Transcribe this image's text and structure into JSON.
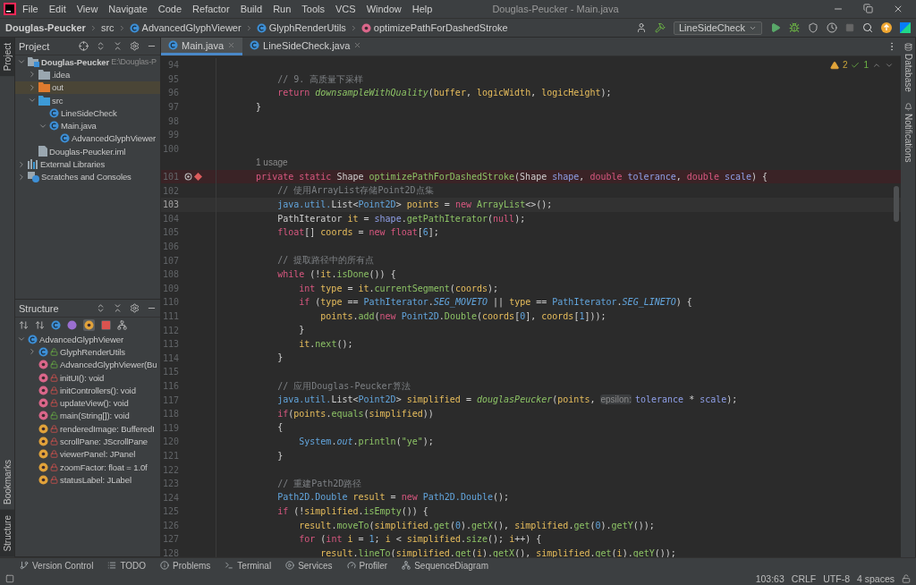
{
  "title_bar": {
    "menu": [
      "File",
      "Edit",
      "View",
      "Navigate",
      "Code",
      "Refactor",
      "Build",
      "Run",
      "Tools",
      "VCS",
      "Window",
      "Help"
    ],
    "title": "Douglas-Peucker - Main.java"
  },
  "nav_bar": {
    "breadcrumbs": [
      {
        "kind": "project",
        "label": "Douglas-Peucker"
      },
      {
        "kind": "folder",
        "label": "src"
      },
      {
        "kind": "class",
        "label": "AdvancedGlyphViewer"
      },
      {
        "kind": "inner-class",
        "label": "GlyphRenderUtils"
      },
      {
        "kind": "method",
        "label": "optimizePathForDashedStroke"
      }
    ],
    "run_config": "LineSideCheck"
  },
  "left_stripe": {
    "top": [
      {
        "label": "Project",
        "selected": true
      }
    ],
    "bottom": [
      {
        "label": "Bookmarks",
        "selected": false
      },
      {
        "label": "Structure",
        "selected": true
      }
    ]
  },
  "right_stripe": [
    {
      "label": "Database"
    },
    {
      "label": "Notifications"
    }
  ],
  "project_panel": {
    "title": "Project",
    "tree": [
      {
        "label": "Douglas-Peucker",
        "hint": "E:\\Douglas-P",
        "kind": "module",
        "expanded": true,
        "selected": false,
        "children": [
          {
            "label": ".idea",
            "kind": "folder",
            "expanded": false,
            "selected": false
          },
          {
            "label": "out",
            "kind": "excluded",
            "expanded": false,
            "selected": true
          },
          {
            "label": "src",
            "kind": "source",
            "expanded": true,
            "selected": false,
            "children": [
              {
                "label": "LineSideCheck",
                "kind": "class",
                "selected": false
              },
              {
                "label": "Main.java",
                "kind": "class",
                "expanded": true,
                "selected": false,
                "children": [
                  {
                    "label": "AdvancedGlyphViewer",
                    "kind": "class",
                    "selected": false
                  }
                ]
              }
            ]
          },
          {
            "label": "Douglas-Peucker.iml",
            "kind": "file",
            "selected": false
          }
        ]
      },
      {
        "label": "External Libraries",
        "kind": "library",
        "expanded": false,
        "selected": false
      },
      {
        "label": "Scratches and Consoles",
        "kind": "scratches",
        "expanded": false,
        "selected": false
      }
    ]
  },
  "structure_panel": {
    "title": "Structure",
    "tree": [
      {
        "label": "AdvancedGlyphViewer",
        "kind": "class",
        "expanded": true,
        "children": [
          {
            "label": "GlyphRenderUtils",
            "kind": "public-class",
            "expanded": false
          },
          {
            "label": "AdvancedGlyphViewer(Bu",
            "kind": "public-method"
          },
          {
            "label": "initUI(): void",
            "kind": "private-method"
          },
          {
            "label": "initControllers(): void",
            "kind": "private-method"
          },
          {
            "label": "updateView(): void",
            "kind": "private-method"
          },
          {
            "label": "main(String[]): void",
            "kind": "public-method"
          },
          {
            "label": "renderedImage: BufferedI",
            "kind": "private-field"
          },
          {
            "label": "scrollPane: JScrollPane",
            "kind": "private-field"
          },
          {
            "label": "viewerPanel: JPanel",
            "kind": "private-field"
          },
          {
            "label": "zoomFactor: float = 1.0f",
            "kind": "private-field"
          },
          {
            "label": "statusLabel: JLabel",
            "kind": "private-field"
          }
        ]
      }
    ]
  },
  "editor": {
    "tabs": [
      {
        "label": "Main.java",
        "selected": true
      },
      {
        "label": "LineSideCheck.java",
        "selected": false
      }
    ],
    "inspections": {
      "warnings": "2",
      "checks": "1"
    },
    "lines": [
      {
        "number": "94",
        "kind": "normal"
      },
      {
        "number": "95",
        "kind": "normal",
        "tokens": [
          {
            "kind": "comment",
            "text": "        // 9. 高质量下采样"
          }
        ]
      },
      {
        "number": "96",
        "kind": "normal",
        "tokens": [
          {
            "kind": "kw",
            "text": "        return "
          },
          {
            "kind": "static",
            "text": "downsampleWithQuality"
          },
          {
            "kind": "plain",
            "text": "("
          },
          {
            "kind": "var",
            "text": "buffer"
          },
          {
            "kind": "plain",
            "text": ", "
          },
          {
            "kind": "var",
            "text": "logicWidth"
          },
          {
            "kind": "plain",
            "text": ", "
          },
          {
            "kind": "var",
            "text": "logicHeight"
          },
          {
            "kind": "plain",
            "text": ");"
          }
        ]
      },
      {
        "number": "97",
        "kind": "normal",
        "tokens": [
          {
            "kind": "plain",
            "text": "    }"
          }
        ]
      },
      {
        "number": "98",
        "kind": "normal"
      },
      {
        "number": "99",
        "kind": "normal"
      },
      {
        "number": "100",
        "kind": "normal"
      },
      {
        "kind": "usage",
        "text": "1 usage"
      },
      {
        "number": "101",
        "kind": "breakpoint",
        "tokens": [
          {
            "kind": "kw",
            "text": "    private static "
          },
          {
            "kind": "plain",
            "text": "Shape "
          },
          {
            "kind": "method",
            "text": "optimizePathForDashedStroke"
          },
          {
            "kind": "plain",
            "text": "(Shape "
          },
          {
            "kind": "param",
            "text": "shape"
          },
          {
            "kind": "plain",
            "text": ", "
          },
          {
            "kind": "kw",
            "text": "double "
          },
          {
            "kind": "param",
            "text": "tolerance"
          },
          {
            "kind": "plain",
            "text": ", "
          },
          {
            "kind": "kw",
            "text": "double "
          },
          {
            "kind": "param",
            "text": "scale"
          },
          {
            "kind": "plain",
            "text": ") {"
          }
        ]
      },
      {
        "number": "102",
        "kind": "normal",
        "tokens": [
          {
            "kind": "comment",
            "text": "        // 使用ArrayList存储Point2D点集"
          }
        ]
      },
      {
        "number": "103",
        "kind": "caret",
        "tokens": [
          {
            "kind": "type",
            "text": "        java.util."
          },
          {
            "kind": "plain",
            "text": "List<"
          },
          {
            "kind": "type",
            "text": "Point2D"
          },
          {
            "kind": "plain",
            "text": "> "
          },
          {
            "kind": "var",
            "text": "points"
          },
          {
            "kind": "plain",
            "text": " = "
          },
          {
            "kind": "kw",
            "text": "new "
          },
          {
            "kind": "method",
            "text": "ArrayList"
          },
          {
            "kind": "plain",
            "text": "<>();"
          }
        ]
      },
      {
        "number": "104",
        "kind": "normal",
        "tokens": [
          {
            "kind": "plain",
            "text": "        PathIterator "
          },
          {
            "kind": "var",
            "text": "it"
          },
          {
            "kind": "plain",
            "text": " = "
          },
          {
            "kind": "param",
            "text": "shape"
          },
          {
            "kind": "plain",
            "text": "."
          },
          {
            "kind": "method",
            "text": "getPathIterator"
          },
          {
            "kind": "plain",
            "text": "("
          },
          {
            "kind": "kw",
            "text": "null"
          },
          {
            "kind": "plain",
            "text": ");"
          }
        ]
      },
      {
        "number": "105",
        "kind": "normal",
        "tokens": [
          {
            "kind": "kw",
            "text": "        float"
          },
          {
            "kind": "plain",
            "text": "[] "
          },
          {
            "kind": "var",
            "text": "coords"
          },
          {
            "kind": "plain",
            "text": " = "
          },
          {
            "kind": "kw",
            "text": "new float"
          },
          {
            "kind": "plain",
            "text": "["
          },
          {
            "kind": "number",
            "text": "6"
          },
          {
            "kind": "plain",
            "text": "];"
          }
        ]
      },
      {
        "number": "106",
        "kind": "normal"
      },
      {
        "number": "107",
        "kind": "normal",
        "tokens": [
          {
            "kind": "comment",
            "text": "        // 提取路径中的所有点"
          }
        ]
      },
      {
        "number": "108",
        "kind": "normal",
        "tokens": [
          {
            "kind": "kw",
            "text": "        while "
          },
          {
            "kind": "plain",
            "text": "(!"
          },
          {
            "kind": "var",
            "text": "it"
          },
          {
            "kind": "plain",
            "text": "."
          },
          {
            "kind": "method",
            "text": "isDone"
          },
          {
            "kind": "plain",
            "text": "()) {"
          }
        ]
      },
      {
        "number": "109",
        "kind": "normal",
        "tokens": [
          {
            "kind": "kw",
            "text": "            int "
          },
          {
            "kind": "var",
            "text": "type"
          },
          {
            "kind": "plain",
            "text": " = "
          },
          {
            "kind": "var",
            "text": "it"
          },
          {
            "kind": "plain",
            "text": "."
          },
          {
            "kind": "method",
            "text": "currentSegment"
          },
          {
            "kind": "plain",
            "text": "("
          },
          {
            "kind": "var",
            "text": "coords"
          },
          {
            "kind": "plain",
            "text": ");"
          }
        ]
      },
      {
        "number": "110",
        "kind": "normal",
        "tokens": [
          {
            "kind": "kw",
            "text": "            if "
          },
          {
            "kind": "plain",
            "text": "("
          },
          {
            "kind": "var",
            "text": "type"
          },
          {
            "kind": "plain",
            "text": " == "
          },
          {
            "kind": "type",
            "text": "PathIterator"
          },
          {
            "kind": "plain",
            "text": "."
          },
          {
            "kind": "const",
            "text": "SEG_MOVETO"
          },
          {
            "kind": "plain",
            "text": " || "
          },
          {
            "kind": "var",
            "text": "type"
          },
          {
            "kind": "plain",
            "text": " == "
          },
          {
            "kind": "type",
            "text": "PathIterator"
          },
          {
            "kind": "plain",
            "text": "."
          },
          {
            "kind": "const",
            "text": "SEG_LINETO"
          },
          {
            "kind": "plain",
            "text": ") {"
          }
        ]
      },
      {
        "number": "111",
        "kind": "normal",
        "tokens": [
          {
            "kind": "var",
            "text": "                points"
          },
          {
            "kind": "plain",
            "text": "."
          },
          {
            "kind": "method",
            "text": "add"
          },
          {
            "kind": "plain",
            "text": "("
          },
          {
            "kind": "kw",
            "text": "new "
          },
          {
            "kind": "type",
            "text": "Point2D"
          },
          {
            "kind": "plain",
            "text": "."
          },
          {
            "kind": "method",
            "text": "Double"
          },
          {
            "kind": "plain",
            "text": "("
          },
          {
            "kind": "var",
            "text": "coords"
          },
          {
            "kind": "plain",
            "text": "["
          },
          {
            "kind": "number",
            "text": "0"
          },
          {
            "kind": "plain",
            "text": "], "
          },
          {
            "kind": "var",
            "text": "coords"
          },
          {
            "kind": "plain",
            "text": "["
          },
          {
            "kind": "number",
            "text": "1"
          },
          {
            "kind": "plain",
            "text": "]));"
          }
        ]
      },
      {
        "number": "112",
        "kind": "normal",
        "tokens": [
          {
            "kind": "plain",
            "text": "            }"
          }
        ]
      },
      {
        "number": "113",
        "kind": "normal",
        "tokens": [
          {
            "kind": "var",
            "text": "            it"
          },
          {
            "kind": "plain",
            "text": "."
          },
          {
            "kind": "method",
            "text": "next"
          },
          {
            "kind": "plain",
            "text": "();"
          }
        ]
      },
      {
        "number": "114",
        "kind": "normal",
        "tokens": [
          {
            "kind": "plain",
            "text": "        }"
          }
        ]
      },
      {
        "number": "115",
        "kind": "normal"
      },
      {
        "number": "116",
        "kind": "normal",
        "tokens": [
          {
            "kind": "comment",
            "text": "        // 应用Douglas-Peucker算法"
          }
        ]
      },
      {
        "number": "117",
        "kind": "normal",
        "tokens": [
          {
            "kind": "type",
            "text": "        java.util."
          },
          {
            "kind": "plain",
            "text": "List<"
          },
          {
            "kind": "type",
            "text": "Point2D"
          },
          {
            "kind": "plain",
            "text": "> "
          },
          {
            "kind": "var",
            "text": "simplified"
          },
          {
            "kind": "plain",
            "text": " = "
          },
          {
            "kind": "static",
            "text": "douglasPeucker"
          },
          {
            "kind": "plain",
            "text": "("
          },
          {
            "kind": "var",
            "text": "points"
          },
          {
            "kind": "plain",
            "text": ", "
          },
          {
            "kind": "hint",
            "text": "epsilon:"
          },
          {
            "kind": "param",
            "text": "tolerance"
          },
          {
            "kind": "plain",
            "text": " * "
          },
          {
            "kind": "param",
            "text": "scale"
          },
          {
            "kind": "plain",
            "text": ");"
          }
        ]
      },
      {
        "number": "118",
        "kind": "normal",
        "tokens": [
          {
            "kind": "kw",
            "text": "        if"
          },
          {
            "kind": "plain",
            "text": "("
          },
          {
            "kind": "var",
            "text": "points"
          },
          {
            "kind": "plain",
            "text": "."
          },
          {
            "kind": "method",
            "text": "equals"
          },
          {
            "kind": "plain",
            "text": "("
          },
          {
            "kind": "var",
            "text": "simplified"
          },
          {
            "kind": "plain",
            "text": "))"
          }
        ]
      },
      {
        "number": "119",
        "kind": "normal",
        "tokens": [
          {
            "kind": "plain",
            "text": "        {"
          }
        ]
      },
      {
        "number": "120",
        "kind": "normal",
        "tokens": [
          {
            "kind": "type",
            "text": "            System"
          },
          {
            "kind": "plain",
            "text": "."
          },
          {
            "kind": "const",
            "text": "out"
          },
          {
            "kind": "plain",
            "text": "."
          },
          {
            "kind": "method",
            "text": "println"
          },
          {
            "kind": "plain",
            "text": "("
          },
          {
            "kind": "string",
            "text": "\"ye\""
          },
          {
            "kind": "plain",
            "text": ");"
          }
        ]
      },
      {
        "number": "121",
        "kind": "normal",
        "tokens": [
          {
            "kind": "plain",
            "text": "        }"
          }
        ]
      },
      {
        "number": "122",
        "kind": "normal"
      },
      {
        "number": "123",
        "kind": "normal",
        "tokens": [
          {
            "kind": "comment",
            "text": "        // 重建Path2D路径"
          }
        ]
      },
      {
        "number": "124",
        "kind": "normal",
        "tokens": [
          {
            "kind": "type",
            "text": "        Path2D.Double "
          },
          {
            "kind": "var",
            "text": "result"
          },
          {
            "kind": "plain",
            "text": " = "
          },
          {
            "kind": "kw",
            "text": "new "
          },
          {
            "kind": "type",
            "text": "Path2D.Double"
          },
          {
            "kind": "plain",
            "text": "();"
          }
        ]
      },
      {
        "number": "125",
        "kind": "normal",
        "tokens": [
          {
            "kind": "kw",
            "text": "        if "
          },
          {
            "kind": "plain",
            "text": "(!"
          },
          {
            "kind": "var",
            "text": "simplified"
          },
          {
            "kind": "plain",
            "text": "."
          },
          {
            "kind": "method",
            "text": "isEmpty"
          },
          {
            "kind": "plain",
            "text": "()) {"
          }
        ]
      },
      {
        "number": "126",
        "kind": "normal",
        "tokens": [
          {
            "kind": "var",
            "text": "            result"
          },
          {
            "kind": "plain",
            "text": "."
          },
          {
            "kind": "method",
            "text": "moveTo"
          },
          {
            "kind": "plain",
            "text": "("
          },
          {
            "kind": "var",
            "text": "simplified"
          },
          {
            "kind": "plain",
            "text": "."
          },
          {
            "kind": "method",
            "text": "get"
          },
          {
            "kind": "plain",
            "text": "("
          },
          {
            "kind": "number",
            "text": "0"
          },
          {
            "kind": "plain",
            "text": ")."
          },
          {
            "kind": "method",
            "text": "getX"
          },
          {
            "kind": "plain",
            "text": "(), "
          },
          {
            "kind": "var",
            "text": "simplified"
          },
          {
            "kind": "plain",
            "text": "."
          },
          {
            "kind": "method",
            "text": "get"
          },
          {
            "kind": "plain",
            "text": "("
          },
          {
            "kind": "number",
            "text": "0"
          },
          {
            "kind": "plain",
            "text": ")."
          },
          {
            "kind": "method",
            "text": "getY"
          },
          {
            "kind": "plain",
            "text": "());"
          }
        ]
      },
      {
        "number": "127",
        "kind": "normal",
        "tokens": [
          {
            "kind": "kw",
            "text": "            for "
          },
          {
            "kind": "plain",
            "text": "("
          },
          {
            "kind": "kw",
            "text": "int "
          },
          {
            "kind": "var",
            "text": "i"
          },
          {
            "kind": "plain",
            "text": " = "
          },
          {
            "kind": "number",
            "text": "1"
          },
          {
            "kind": "plain",
            "text": "; "
          },
          {
            "kind": "var",
            "text": "i"
          },
          {
            "kind": "plain",
            "text": " < "
          },
          {
            "kind": "var",
            "text": "simplified"
          },
          {
            "kind": "plain",
            "text": "."
          },
          {
            "kind": "method",
            "text": "size"
          },
          {
            "kind": "plain",
            "text": "(); "
          },
          {
            "kind": "var",
            "text": "i"
          },
          {
            "kind": "plain",
            "text": "++) {"
          }
        ]
      },
      {
        "number": "128",
        "kind": "normal",
        "tokens": [
          {
            "kind": "var",
            "text": "                result"
          },
          {
            "kind": "plain",
            "text": "."
          },
          {
            "kind": "method",
            "text": "lineTo"
          },
          {
            "kind": "plain",
            "text": "("
          },
          {
            "kind": "var",
            "text": "simplified"
          },
          {
            "kind": "plain",
            "text": "."
          },
          {
            "kind": "method",
            "text": "get"
          },
          {
            "kind": "plain",
            "text": "("
          },
          {
            "kind": "var",
            "text": "i"
          },
          {
            "kind": "plain",
            "text": ")."
          },
          {
            "kind": "method",
            "text": "getX"
          },
          {
            "kind": "plain",
            "text": "(), "
          },
          {
            "kind": "var",
            "text": "simplified"
          },
          {
            "kind": "plain",
            "text": "."
          },
          {
            "kind": "method",
            "text": "get"
          },
          {
            "kind": "plain",
            "text": "("
          },
          {
            "kind": "var",
            "text": "i"
          },
          {
            "kind": "plain",
            "text": ")."
          },
          {
            "kind": "method",
            "text": "getY"
          },
          {
            "kind": "plain",
            "text": "());"
          }
        ]
      }
    ]
  },
  "bottom_tools": [
    {
      "kind": "vcs",
      "label": "Version Control"
    },
    {
      "kind": "todo",
      "label": "TODO"
    },
    {
      "kind": "problems",
      "label": "Problems"
    },
    {
      "kind": "terminal",
      "label": "Terminal"
    },
    {
      "kind": "services",
      "label": "Services"
    },
    {
      "kind": "profiler",
      "label": "Profiler"
    },
    {
      "kind": "sequence",
      "label": "SequenceDiagram"
    }
  ],
  "status_bar": {
    "items": [
      "103:63",
      "CRLF",
      "UTF-8",
      "4 spaces"
    ]
  }
}
